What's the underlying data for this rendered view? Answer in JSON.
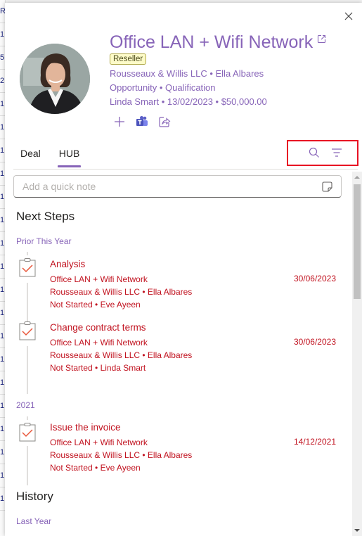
{
  "background_list": {
    "rows": [
      "R",
      "1",
      "5",
      "2",
      "1",
      "1",
      "1",
      "1",
      "1",
      "1",
      "1",
      "1",
      "1",
      "1",
      "1",
      "1",
      "1",
      "1",
      "1",
      "1",
      "1",
      "1"
    ]
  },
  "header": {
    "title": "Office LAN + Wifi Network",
    "badge": "Reseller",
    "account_line": "Rousseaux & Willis LLC • Ella Albares",
    "type_line": "Opportunity • Qualification",
    "owner_line": "Linda Smart • 13/02/2023 • $50,000.00"
  },
  "icons": {
    "close": "close-icon",
    "open_external": "open-external-icon",
    "add": "plus-icon",
    "teams": "teams-icon",
    "share": "share-icon",
    "search": "search-icon",
    "filter": "filter-icon",
    "note": "sticky-note-icon",
    "task": "task-clipboard-icon"
  },
  "tabs": [
    {
      "label": "Deal",
      "active": false
    },
    {
      "label": "HUB",
      "active": true
    }
  ],
  "quick_note": {
    "placeholder": "Add a quick note",
    "value": ""
  },
  "next_steps": {
    "title": "Next Steps",
    "groups": [
      {
        "label": "Prior This Year",
        "tasks": [
          {
            "title": "Analysis",
            "deal": "Office LAN + Wifi Network",
            "date": "30/06/2023",
            "account": "Rousseaux & Willis LLC • Ella Albares",
            "status": "Not Started • Eve Ayeen"
          },
          {
            "title": "Change contract terms",
            "deal": "Office LAN + Wifi Network",
            "date": "30/06/2023",
            "account": "Rousseaux & Willis LLC • Ella Albares",
            "status": "Not Started • Linda Smart"
          }
        ]
      },
      {
        "label": "2021",
        "tasks": [
          {
            "title": "Issue the invoice",
            "deal": "Office LAN + Wifi Network",
            "date": "14/12/2021",
            "account": "Rousseaux & Willis LLC • Ella Albares",
            "status": "Not Started • Eve Ayeen"
          }
        ]
      }
    ]
  },
  "history": {
    "title": "History",
    "groups": [
      {
        "label": "Last Year"
      }
    ]
  },
  "colors": {
    "accent": "#8764b8",
    "task_text": "#c1121f",
    "task_check": "#e8563a",
    "highlight_box": "#e81123",
    "badge_bg": "#fdfbc8"
  }
}
